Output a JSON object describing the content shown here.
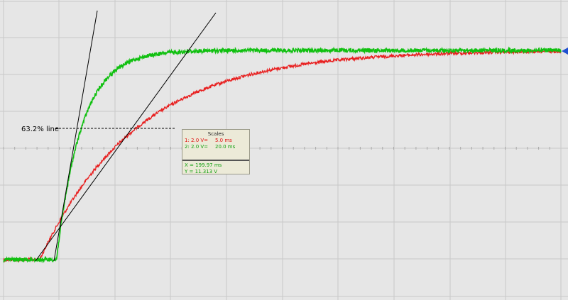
{
  "chart_data": {
    "type": "line",
    "title": "",
    "xlabel": "",
    "ylabel": "",
    "annotation": "63.2% line",
    "grid": true,
    "scales": {
      "title": "Scales",
      "channel1": {
        "volts": "1: 2.0 V=",
        "time": "5.0 ms"
      },
      "channel2": {
        "volts": "2: 2.0 V=",
        "time": "20.0 ms"
      }
    },
    "cursor": {
      "x": "X = 199.97 ms",
      "y": "Y = 11.313 V"
    },
    "series": [
      {
        "channel": 1,
        "color": "#e82020",
        "step_at_fraction": 0.065,
        "tau_fraction": 0.175,
        "start_level": 0.0,
        "end_level": 1.0
      },
      {
        "channel": 2,
        "color": "#10c010",
        "step_at_fraction": 0.095,
        "tau_fraction": 0.045,
        "start_level": 0.0,
        "end_level": 1.0
      }
    ]
  }
}
